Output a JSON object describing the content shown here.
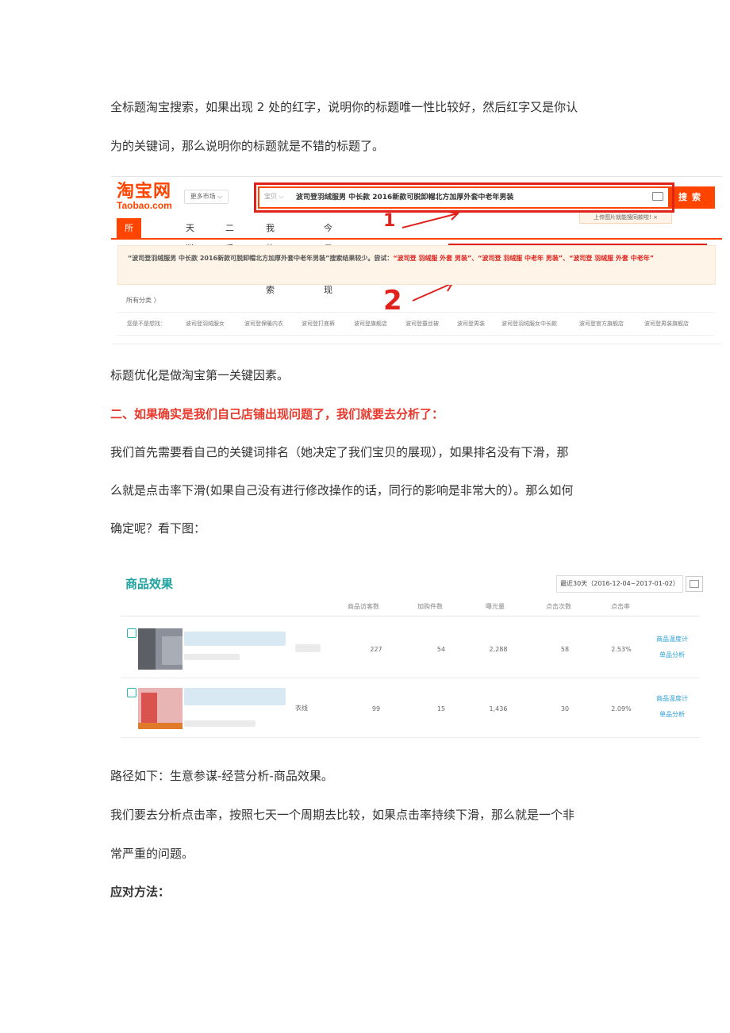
{
  "paragraphs": {
    "p1_line1": "全标题淘宝搜索，如果出现 2 处的红字，说明你的标题唯一性比较好，然后红字又是你认",
    "p1_line2": "为的关键词，那么说明你的标题就是不错的标题了。",
    "p2": "标题优化是做淘宝第一关键因素。",
    "heading2": "二、如果确实是我们自己店铺出现问题了，我们就要去分析了：",
    "p3_line1": "我们首先需要看自己的关键词排名（她决定了我们宝贝的展现），如果排名没有下滑，那",
    "p3_line2": "么就是点击率下滑(如果自己没有进行修改操作的话，同行的影响是非常大的）。那么如何",
    "p3_line3": "确定呢？看下图：",
    "p4": "路径如下：生意参谋-经营分析-商品效果。",
    "p5_line1": "我们要去分析点击率，按照七天一个周期去比较，如果点击率持续下滑，那么就是一个非",
    "p5_line2": "常严重的问题。",
    "heading3": "应对方法："
  },
  "taobao": {
    "logo_cn": "淘宝网",
    "logo_en": "Taobao.com",
    "market": "更多市场 ⌵",
    "search_type": "宝贝  ⌵",
    "search_query": "波司登羽绒服男 中长款 2016新款可脱卸帽北方加厚外套中老年男装",
    "search_button": "搜索",
    "upload_tip": "上传图片就能搜同款啦!  ×",
    "tabs": [
      "所有宝贝",
      "天猫",
      "二手",
      "我的搜索",
      "今日发现"
    ],
    "notice_prefix": "“波司登羽绒服男 中长款 2016新款可脱卸帽北方加厚外套中老年男装”搜索结果较少。尝试：",
    "notice_suggest": "“波司登 羽绒服 外套 男装”、“波司登 羽绒服 中老年 男装”、“波司登 羽绒服 外套 中老年”",
    "all_categories": "所有分类 〉",
    "related_label": "您是不是想找：",
    "related": [
      "波司登羽绒服女",
      "波司登保暖内衣",
      "波司登打底裤",
      "波司登旗舰店",
      "波司登蚕丝被",
      "波司登男装",
      "波司登羽绒服女中长款",
      "波司登官方旗舰店",
      "波司登男装旗舰店"
    ],
    "mark1": "1",
    "mark2": "2",
    "accent": "#ff4400",
    "mark_color": "#e0221c"
  },
  "product_effect": {
    "title": "商品效果",
    "date_range": "最近30天（2016-12-04~2017-01-02）",
    "calendar_icon": "calendar-icon",
    "columns": [
      "商品访客数",
      "加购件数",
      "曝光量",
      "点击次数",
      "点击率"
    ],
    "rows": [
      {
        "visitors": "227",
        "cart": "54",
        "exposure": "2,288",
        "clicks": "58",
        "ctr": "2.53%",
        "suffix": ""
      },
      {
        "visitors": "99",
        "cart": "15",
        "exposure": "1,436",
        "clicks": "30",
        "ctr": "2.09%",
        "suffix": "衣线"
      }
    ],
    "actions": [
      "商品温度计",
      "单品分析"
    ],
    "accent": "#1fa3a0"
  }
}
